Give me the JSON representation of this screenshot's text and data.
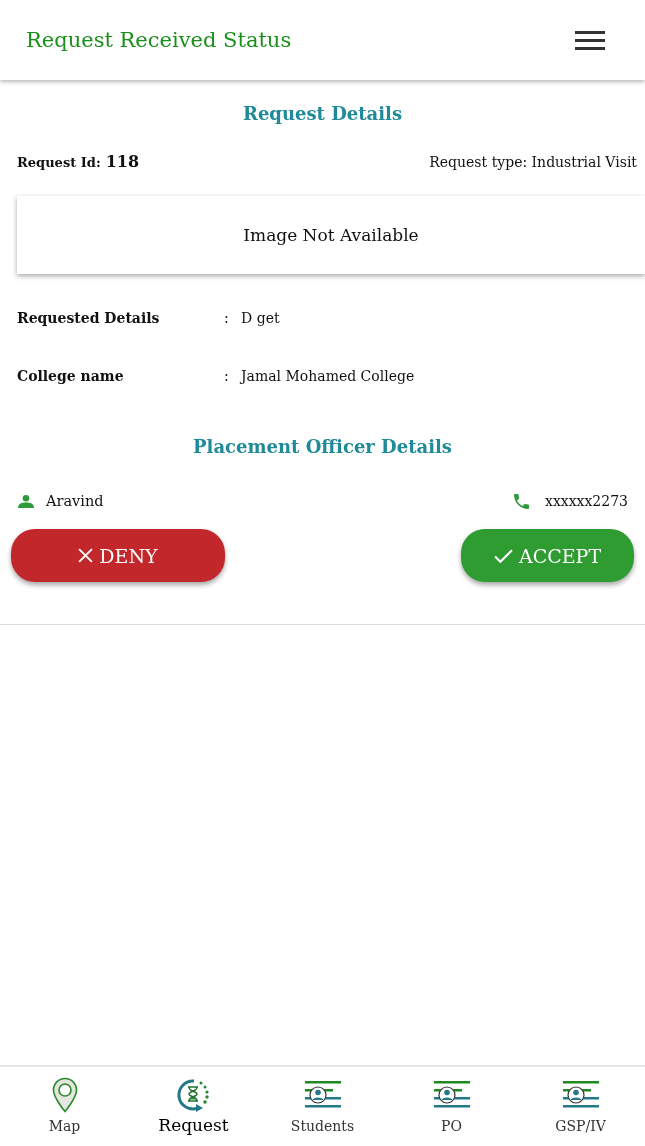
{
  "header": {
    "title": "Request Received Status"
  },
  "request_details": {
    "heading": "Request Details",
    "id_label": "Request Id:",
    "id_value": "118",
    "type_text": "Request type: Industrial Visit",
    "image_text": "Image Not Available",
    "fields": [
      {
        "label": "Requested Details",
        "separator": ":",
        "value": "D get"
      },
      {
        "label": "College name",
        "separator": ":",
        "value": "Jamal Mohamed College"
      }
    ]
  },
  "placement_officer": {
    "heading": "Placement Officer Details",
    "name": "Aravind",
    "phone": "xxxxxx2273"
  },
  "actions": [
    {
      "kind": "deny",
      "label": "DENY"
    },
    {
      "kind": "accept",
      "label": "ACCEPT"
    }
  ],
  "bottom_nav": [
    {
      "kind": "map",
      "label": "Map",
      "selected": false
    },
    {
      "kind": "request",
      "label": "Request",
      "selected": true
    },
    {
      "kind": "list",
      "label": "Students",
      "selected": false
    },
    {
      "kind": "list",
      "label": "PO",
      "selected": false
    },
    {
      "kind": "list",
      "label": "GSP/IV",
      "selected": false
    }
  ]
}
